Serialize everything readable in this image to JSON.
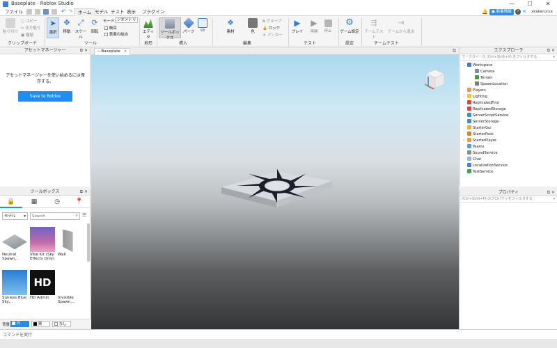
{
  "window": {
    "title": "Baseplate - Roblox Studio",
    "min": "—",
    "max": "☐",
    "close": "✕"
  },
  "menu": {
    "file": "ファイル",
    "tabs": [
      "ホーム",
      "モデル",
      "テスト",
      "表示",
      "プラグイン"
    ]
  },
  "top_right": {
    "news_label": "新着情報",
    "username": "xkakerurux"
  },
  "ribbon": {
    "clipboard": {
      "paste": "貼り付け",
      "copy": "コピー",
      "cut": "切り取り",
      "duplicate": "複製",
      "label": "クリップボード"
    },
    "tools": {
      "select": "選択",
      "move": "移動",
      "scale": "スケール",
      "rotate": "回転",
      "mode_label": "モード:",
      "mode_value": "ジオメトリ",
      "collisions": "衝突",
      "join_surfaces": "表面の結合",
      "label": "ツール"
    },
    "terrain": {
      "editor": "エディタ",
      "label": "地形"
    },
    "insert": {
      "toolbox": "ツールボックス",
      "part": "パーツ",
      "ui": "UI",
      "label": "挿入"
    },
    "edit": {
      "material": "素材",
      "color": "色",
      "group": "グループ",
      "lock": "ロック",
      "anchor": "アンカー",
      "label": "編集"
    },
    "test": {
      "play": "プレイ",
      "resume": "再開",
      "stop": "停止",
      "label": "テスト"
    },
    "settings": {
      "game_settings": "ゲーム設定",
      "label": "設定"
    },
    "team_test": {
      "team_test": "チームテスト",
      "exit_game": "ゲームから退出",
      "label": "チームテスト"
    }
  },
  "asset_manager": {
    "title": "アセットマネージャー",
    "message": "アセットマネージャーを使い始めるには保存する。",
    "save_button": "Save to Roblox"
  },
  "toolbox": {
    "title": "ツールボックス",
    "category": "モデル",
    "search_placeholder": "Search",
    "items": [
      {
        "name": "Neutral Spawn…"
      },
      {
        "name": "Vibe Kit (Sky Effects Only)"
      },
      {
        "name": "Wall"
      },
      {
        "name": "Sunless Blue Sky…"
      },
      {
        "name": "HD Admin"
      },
      {
        "name": "Invisible Spawn…"
      }
    ],
    "background_label": "背景:",
    "bg_white": "白",
    "bg_black": "黒",
    "bg_none": "なし"
  },
  "viewport": {
    "tab": "Baseplate"
  },
  "explorer": {
    "title": "エクスプローラ",
    "filter_placeholder": "ワークスペース (Ctrl+Shift+X) をフィルタする",
    "items": [
      {
        "label": "Workspace",
        "depth": 0,
        "expanded": "open",
        "color": "#3a7bd5"
      },
      {
        "label": "Camera",
        "depth": 1,
        "expanded": "",
        "color": "#7a8fa6"
      },
      {
        "label": "Terrain",
        "depth": 1,
        "expanded": "",
        "color": "#4c9a3f"
      },
      {
        "label": "SpawnLocation",
        "depth": 1,
        "expanded": "closed",
        "color": "#7c7c7c"
      },
      {
        "label": "Players",
        "depth": 0,
        "expanded": "",
        "color": "#e0a34a"
      },
      {
        "label": "Lighting",
        "depth": 0,
        "expanded": "closed",
        "color": "#f3c33b"
      },
      {
        "label": "ReplicatedFirst",
        "depth": 0,
        "expanded": "",
        "color": "#d14b4b"
      },
      {
        "label": "ReplicatedStorage",
        "depth": 0,
        "expanded": "",
        "color": "#d14b4b"
      },
      {
        "label": "ServerScriptService",
        "depth": 0,
        "expanded": "",
        "color": "#3e8ed0"
      },
      {
        "label": "ServerStorage",
        "depth": 0,
        "expanded": "",
        "color": "#3e8ed0"
      },
      {
        "label": "StarterGui",
        "depth": 0,
        "expanded": "",
        "color": "#e6b342"
      },
      {
        "label": "StarterPack",
        "depth": 0,
        "expanded": "",
        "color": "#c48a3a"
      },
      {
        "label": "StarterPlayer",
        "depth": 0,
        "expanded": "closed",
        "color": "#e0a34a"
      },
      {
        "label": "Teams",
        "depth": 0,
        "expanded": "",
        "color": "#4aa3df"
      },
      {
        "label": "SoundService",
        "depth": 0,
        "expanded": "",
        "color": "#8e8e8e"
      },
      {
        "label": "Chat",
        "depth": 0,
        "expanded": "",
        "color": "#9bb7d4"
      },
      {
        "label": "LocalizationService",
        "depth": 0,
        "expanded": "",
        "color": "#4d7fc4"
      },
      {
        "label": "TestService",
        "depth": 0,
        "expanded": "",
        "color": "#3aa655"
      }
    ]
  },
  "properties": {
    "title": "プロパティ",
    "filter_placeholder": "(Ctrl+Shift+P) のプロパティをフィルタする"
  },
  "command_bar": {
    "placeholder": "コマンドを実行"
  }
}
